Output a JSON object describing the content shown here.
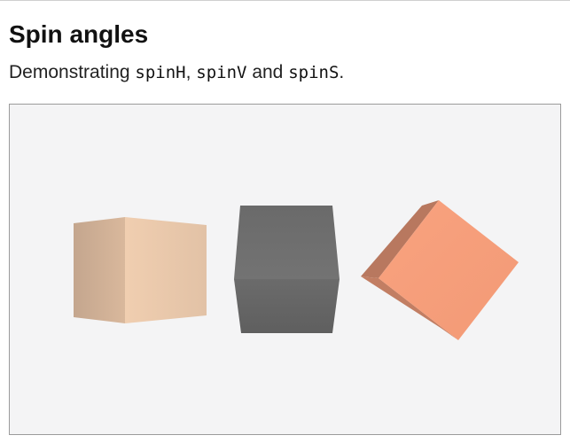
{
  "page": {
    "title": "Spin angles",
    "description": {
      "lead": "Demonstrating ",
      "code1": "spinH",
      "sep1": ", ",
      "code2": "spinV",
      "sep2": " and ",
      "code3": "spinS",
      "end": "."
    }
  },
  "scene": {
    "background": "#f4f4f5",
    "cubes": [
      {
        "name": "beige-cube",
        "spin": "spinH",
        "color": "#e9c6a7"
      },
      {
        "name": "gray-cube",
        "spin": "spinV",
        "color": "#6d6d6d"
      },
      {
        "name": "salmon-cube",
        "spin": "spinS",
        "color": "#f59b76"
      }
    ]
  }
}
